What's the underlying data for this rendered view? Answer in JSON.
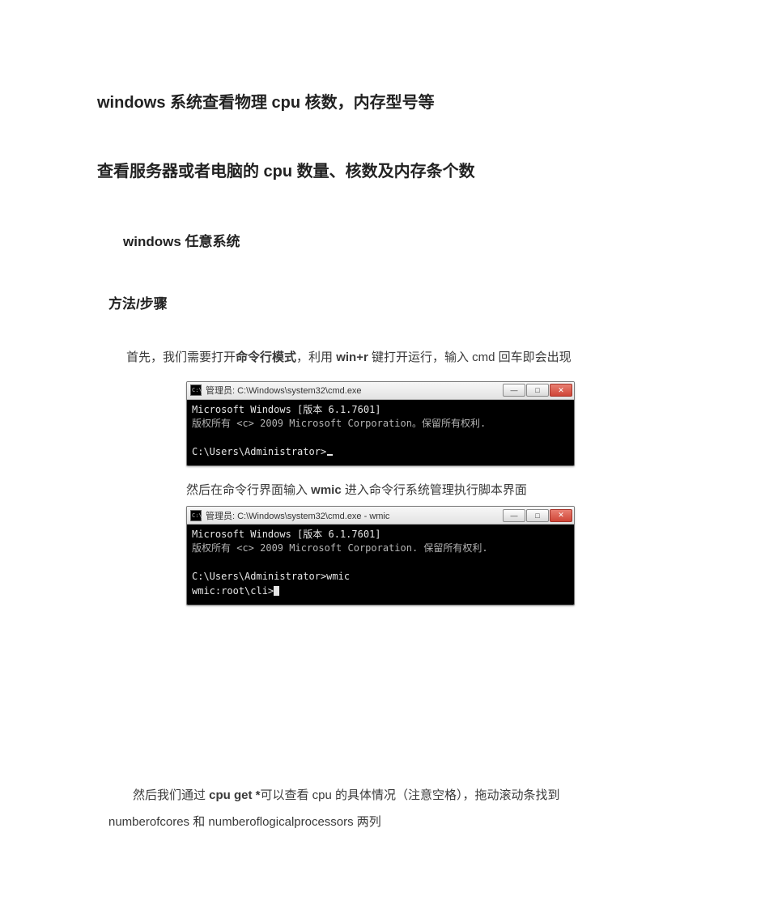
{
  "title": "windows 系统查看物理 cpu 核数，内存型号等",
  "subtitle": "查看服务器或者电脑的 cpu 数量、核数及内存条个数",
  "section_tool": "windows 任意系统",
  "method_heading": "方法/步骤",
  "step1": {
    "prefix": "首先，我们需要打开",
    "bold1": "命令行模式",
    "mid": "，利用",
    "bold2": " win+r ",
    "suffix": "键打开运行，输入 cmd 回车即会出现"
  },
  "cmd1": {
    "title": "管理员: C:\\Windows\\system32\\cmd.exe",
    "line1": "Microsoft Windows [版本 6.1.7601]",
    "line2": "版权所有 <c> 2009 Microsoft Corporation。保留所有权利.",
    "prompt": "C:\\Users\\Administrator>"
  },
  "step2": {
    "prefix": "然后在命令行界面输入 ",
    "bold": "wmic",
    "suffix": " 进入命令行系统管理执行脚本界面"
  },
  "cmd2": {
    "title": "管理员: C:\\Windows\\system32\\cmd.exe - wmic",
    "line1": "Microsoft Windows [版本 6.1.7601]",
    "line2": "版权所有 <c> 2009 Microsoft Corporation. 保留所有权利.",
    "line3": "C:\\Users\\Administrator>wmic",
    "line4": "wmic:root\\cli>"
  },
  "step3": {
    "seg1": "然后我们通过 ",
    "bold1": "cpu get *",
    "seg2": "可以查看 cpu 的具体情况（注意空格），拖动滚动条找到",
    "line2": "numberofcores 和 numberoflogicalprocessors 两列"
  },
  "win_btn": {
    "min": "—",
    "max": "□",
    "close": "✕"
  }
}
